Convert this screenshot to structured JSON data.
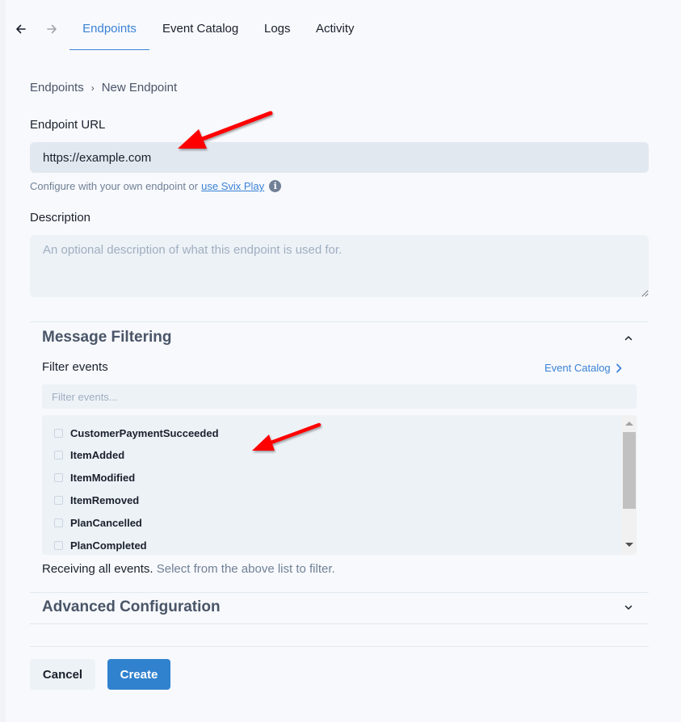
{
  "nav": {
    "back_icon": "arrow-left-icon",
    "forward_icon": "arrow-right-icon",
    "tabs": [
      {
        "label": "Endpoints",
        "active": true
      },
      {
        "label": "Event Catalog",
        "active": false
      },
      {
        "label": "Logs",
        "active": false
      },
      {
        "label": "Activity",
        "active": false
      }
    ]
  },
  "breadcrumb": {
    "items": [
      "Endpoints",
      "New Endpoint"
    ],
    "separator": "›"
  },
  "form": {
    "endpoint_url": {
      "label": "Endpoint URL",
      "value": "https://example.com",
      "help_text": "Configure with your own endpoint or",
      "help_link": "use Svix Play",
      "info_icon": "i"
    },
    "description": {
      "label": "Description",
      "value": "",
      "placeholder": "An optional description of what this endpoint is used for."
    }
  },
  "message_filtering": {
    "title": "Message Filtering",
    "expanded": true,
    "filter_label": "Filter events",
    "catalog_link": "Event Catalog",
    "filter_placeholder": "Filter events...",
    "events": [
      {
        "name": "CustomerPaymentSucceeded",
        "checked": false
      },
      {
        "name": "ItemAdded",
        "checked": false
      },
      {
        "name": "ItemModified",
        "checked": false
      },
      {
        "name": "ItemRemoved",
        "checked": false
      },
      {
        "name": "PlanCancelled",
        "checked": false
      },
      {
        "name": "PlanCompleted",
        "checked": false
      }
    ],
    "status_main": "Receiving all events.",
    "status_hint": "Select from the above list to filter."
  },
  "advanced_configuration": {
    "title": "Advanced Configuration",
    "expanded": false
  },
  "actions": {
    "cancel_label": "Cancel",
    "create_label": "Create"
  },
  "colors": {
    "accent": "#3b82d6",
    "primary_button": "#3182ce",
    "annotation_arrow": "#ff0000"
  }
}
